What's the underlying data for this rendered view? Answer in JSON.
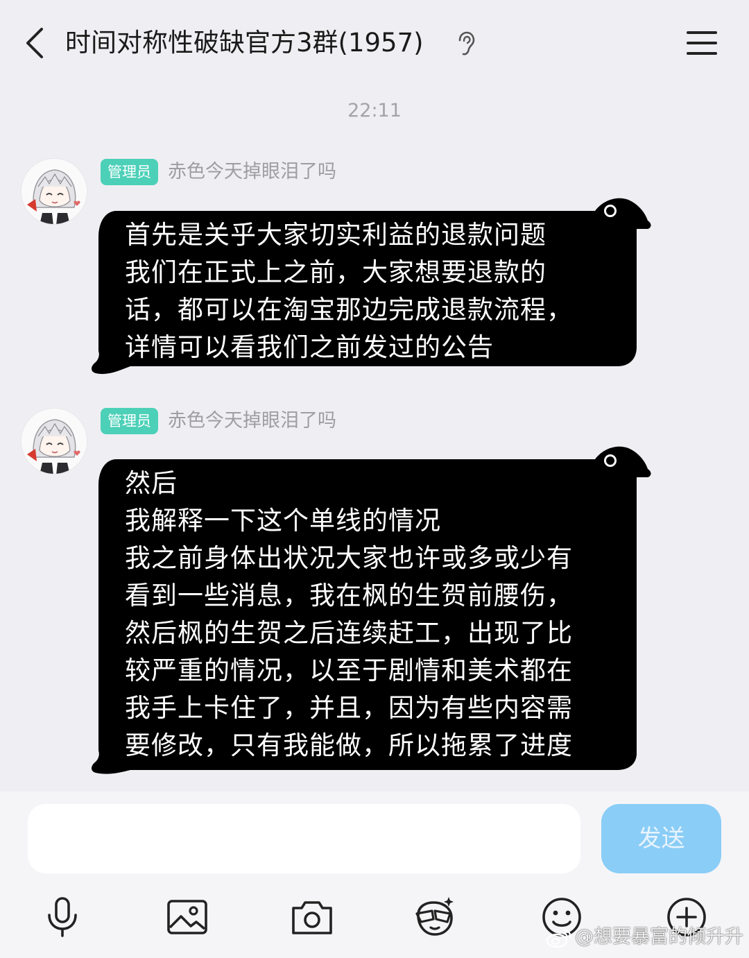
{
  "header": {
    "title": "时间对称性破缺官方3群(1957)",
    "back_icon": "chevron-left-icon",
    "ear_icon": "ear-icon",
    "menu_icon": "hamburger-menu-icon"
  },
  "timestamp": "22:11",
  "messages": [
    {
      "role": "管理员",
      "sender": "赤色今天掉眼泪了吗",
      "lines": [
        "首先是关乎大家切实利益的退款问题",
        "我们在正式上之前，大家想要退款的",
        "话，都可以在淘宝那边完成退款流程，",
        "详情可以看我们之前发过的公告"
      ]
    },
    {
      "role": "管理员",
      "sender": "赤色今天掉眼泪了吗",
      "lines": [
        "然后",
        "我解释一下这个单线的情况",
        "我之前身体出状况大家也许或多或少有",
        "看到一些消息，我在枫的生贺前腰伤，",
        "然后枫的生贺之后连续赶工，出现了比",
        "较严重的情况，以至于剧情和美术都在",
        "我手上卡住了，并且，因为有些内容需",
        "要修改，只有我能做，所以拖累了进度"
      ]
    }
  ],
  "input": {
    "value": "",
    "send_label": "发送"
  },
  "toolbar": [
    "microphone-icon",
    "image-icon",
    "camera-icon",
    "sticker-face-icon",
    "emoji-icon",
    "plus-circle-icon"
  ],
  "watermark": "@想要暴富的倾升升",
  "colors": {
    "background": "#efeff3",
    "bubble": "#000000",
    "badge": "#4dd0b8",
    "send_button": "#8acdf7"
  }
}
